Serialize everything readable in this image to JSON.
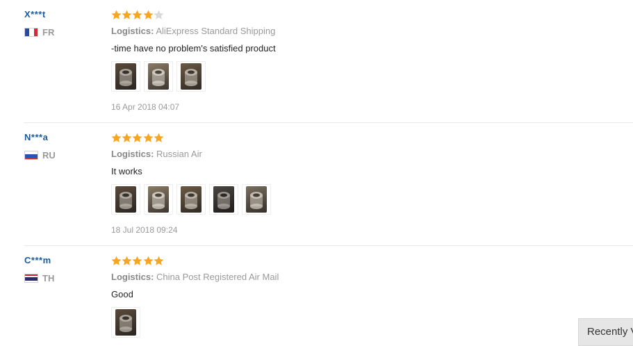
{
  "reviews": [
    {
      "user": "X***t",
      "country": "FR",
      "flag": "france",
      "rating": 4,
      "logistics_label": "Logistics:",
      "logistics_value": "AliExpress Standard Shipping",
      "text": "-time have no problem's satisfied product",
      "photo_count": 3,
      "date": "16 Apr 2018 04:07"
    },
    {
      "user": "N***a",
      "country": "RU",
      "flag": "russia",
      "rating": 5,
      "logistics_label": "Logistics:",
      "logistics_value": "Russian Air",
      "text": "It works",
      "photo_count": 5,
      "date": "18 Jul 2018 09:24"
    },
    {
      "user": "C***m",
      "country": "TH",
      "flag": "thailand",
      "rating": 5,
      "logistics_label": "Logistics:",
      "logistics_value": "China Post Registered Air Mail",
      "text": "Good",
      "photo_count": 1,
      "date": ""
    }
  ],
  "recently_viewed_label": "Recently Viewed",
  "colors": {
    "star_filled": "#f5a623",
    "star_empty": "#d9d9d9",
    "username": "#1a5a9c"
  }
}
